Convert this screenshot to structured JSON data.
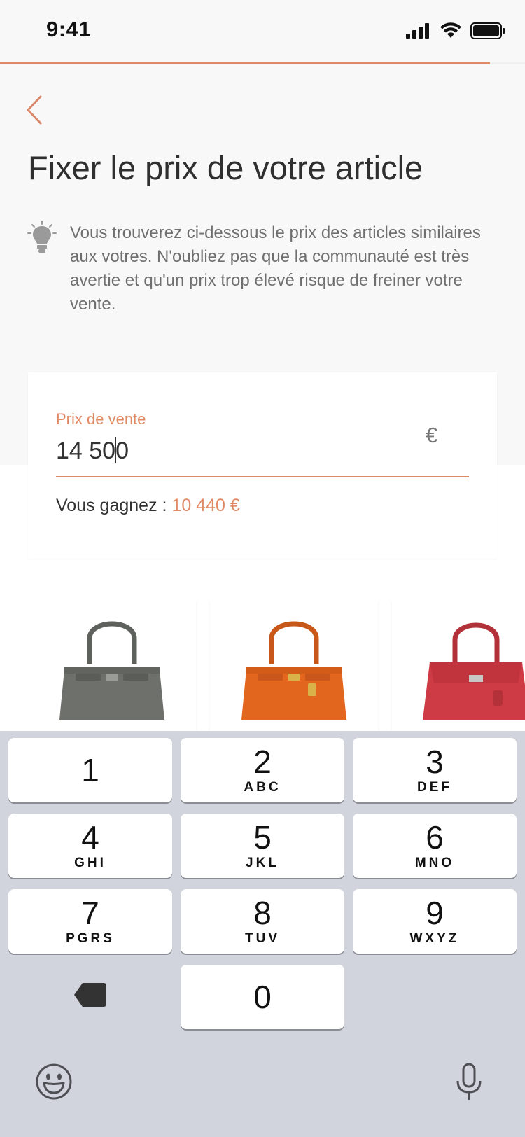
{
  "status_bar": {
    "time": "9:41"
  },
  "progress": {
    "fraction": 0.933
  },
  "header": {
    "title": "Fixer le prix de votre article"
  },
  "tip": {
    "text": "Vous trouverez ci-dessous le prix des articles similaires aux votres. N'oubliez pas que la communauté est très avertie et qu'un prix trop élevé risque de freiner votre vente."
  },
  "price_form": {
    "label": "Prix de vente",
    "value": "14 500",
    "currency": "€",
    "earn_label": "Vous gagnez :",
    "earn_value": "10 440 €"
  },
  "products": [
    {
      "color": "#6e706b",
      "icon": "grey-bag"
    },
    {
      "color": "#e2661d",
      "icon": "orange-bag"
    },
    {
      "color": "#cf3b44",
      "icon": "red-bag"
    }
  ],
  "keypad": {
    "keys": [
      {
        "digit": "1",
        "letters": ""
      },
      {
        "digit": "2",
        "letters": "ABC"
      },
      {
        "digit": "3",
        "letters": "DEF"
      },
      {
        "digit": "4",
        "letters": "GHI"
      },
      {
        "digit": "5",
        "letters": "JKL"
      },
      {
        "digit": "6",
        "letters": "MNO"
      },
      {
        "digit": "7",
        "letters": "PGRS"
      },
      {
        "digit": "8",
        "letters": "TUV"
      },
      {
        "digit": "9",
        "letters": "WXYZ"
      },
      {
        "digit": "0",
        "letters": ""
      }
    ]
  },
  "colors": {
    "accent": "#e08a65",
    "keyboard_bg": "#d1d4dc"
  }
}
